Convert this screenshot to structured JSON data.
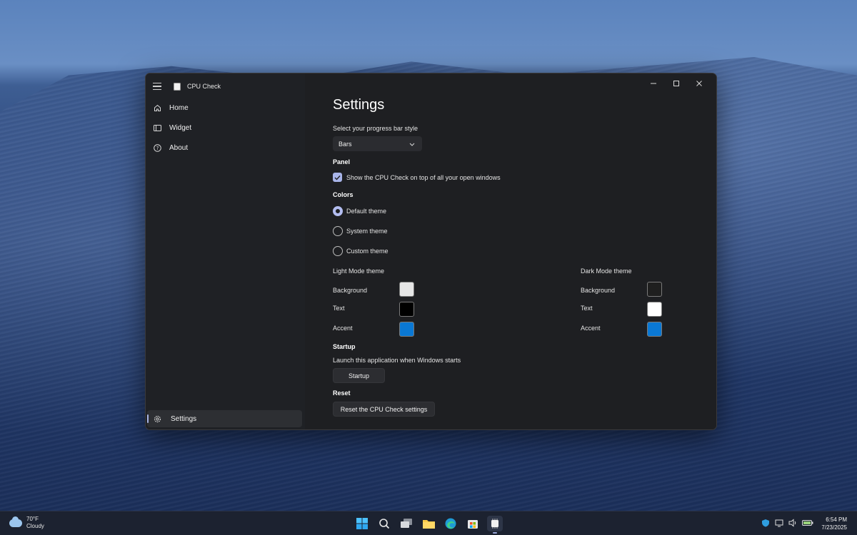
{
  "app": {
    "title": "CPU Check"
  },
  "nav": {
    "items": [
      {
        "label": "Home",
        "icon": "home-icon"
      },
      {
        "label": "Widget",
        "icon": "widget-icon"
      },
      {
        "label": "About",
        "icon": "about-icon"
      }
    ],
    "settings_label": "Settings"
  },
  "settings": {
    "title": "Settings",
    "progress_label": "Select your progress bar style",
    "progress_value": "Bars",
    "panel_header": "Panel",
    "panel_checkbox_label": "Show the CPU Check on top of all your open windows",
    "panel_checked": true,
    "colors_header": "Colors",
    "themes": [
      {
        "label": "Default theme",
        "selected": true
      },
      {
        "label": "System theme",
        "selected": false
      },
      {
        "label": "Custom theme",
        "selected": false
      }
    ],
    "light_mode": {
      "title": "Light Mode theme",
      "background_label": "Background",
      "background_color": "#e6e6e6",
      "text_label": "Text",
      "text_color": "#000000",
      "accent_label": "Accent",
      "accent_color": "#0a78d4"
    },
    "dark_mode": {
      "title": "Dark Mode theme",
      "background_label": "Background",
      "background_color": "#1f1f1f",
      "text_label": "Text",
      "text_color": "#ffffff",
      "accent_label": "Accent",
      "accent_color": "#0a78d4"
    },
    "startup_header": "Startup",
    "startup_label": "Launch this application when Windows starts",
    "startup_button": "Startup",
    "reset_header": "Reset",
    "reset_button": "Reset the CPU Check settings"
  },
  "taskbar": {
    "weather_temp": "70°F",
    "weather_desc": "Cloudy",
    "time": "6:54 PM",
    "date": "7/23/2025",
    "icons": [
      "start-icon",
      "search-icon",
      "task-view-icon",
      "file-explorer-icon",
      "edge-icon",
      "store-icon",
      "cpu-check-icon"
    ]
  }
}
